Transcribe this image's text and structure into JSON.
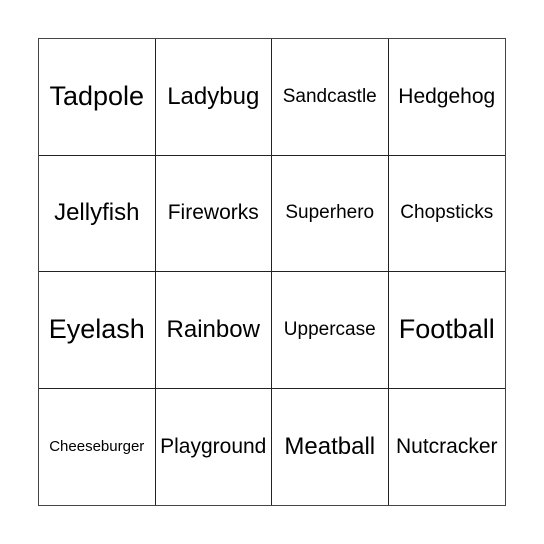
{
  "bingo_card": {
    "cells": [
      {
        "label": "Tadpole",
        "size": "xl"
      },
      {
        "label": "Ladybug",
        "size": "lg"
      },
      {
        "label": "Sandcastle",
        "size": "sm"
      },
      {
        "label": "Hedgehog",
        "size": "md"
      },
      {
        "label": "Jellyfish",
        "size": "lg"
      },
      {
        "label": "Fireworks",
        "size": "md"
      },
      {
        "label": "Superhero",
        "size": "sm"
      },
      {
        "label": "Chopsticks",
        "size": "sm"
      },
      {
        "label": "Eyelash",
        "size": "xl"
      },
      {
        "label": "Rainbow",
        "size": "lg"
      },
      {
        "label": "Uppercase",
        "size": "sm"
      },
      {
        "label": "Football",
        "size": "xl"
      },
      {
        "label": "Cheeseburger",
        "size": "xs"
      },
      {
        "label": "Playground",
        "size": "md"
      },
      {
        "label": "Meatball",
        "size": "lg"
      },
      {
        "label": "Nutcracker",
        "size": "md"
      }
    ]
  }
}
